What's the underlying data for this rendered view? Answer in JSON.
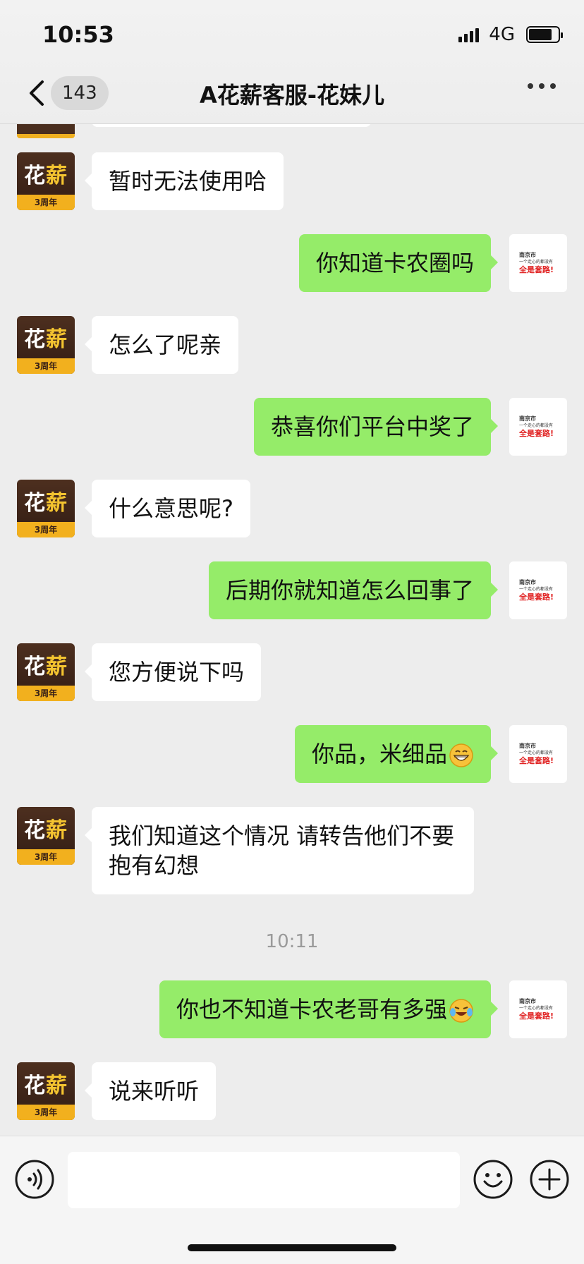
{
  "status_bar": {
    "time": "10:53",
    "network": "4G"
  },
  "header": {
    "back_icon": "chevron-left-icon",
    "unread_count": "143",
    "title": "A花薪客服-花妹儿",
    "more_icon": "more-dots-icon"
  },
  "avatars": {
    "agent": {
      "logo_main": "花",
      "logo_accent": "薪",
      "band": "3周年"
    },
    "user": {
      "line1": "南京市",
      "line2": "一个走心的都没有",
      "line3": "全是套路!"
    }
  },
  "messages": [
    {
      "side": "left",
      "text": "暂时无法使用哈"
    },
    {
      "side": "right",
      "text": "你知道卡农圈吗"
    },
    {
      "side": "left",
      "text": "怎么了呢亲"
    },
    {
      "side": "right",
      "text": "恭喜你们平台中奖了"
    },
    {
      "side": "left",
      "text": "什么意思呢?"
    },
    {
      "side": "right",
      "text": "后期你就知道怎么回事了"
    },
    {
      "side": "left",
      "text": "您方便说下吗"
    },
    {
      "side": "right",
      "text": "你品，米细品",
      "emoji": "grin-emoji-icon"
    },
    {
      "side": "left",
      "text": "我们知道这个情况 请转告他们不要抱有幻想"
    },
    {
      "side": "right",
      "text": "你也不知道卡农老哥有多强",
      "emoji": "laugh-cry-emoji-icon"
    },
    {
      "side": "left",
      "text": "说来听听"
    }
  ],
  "timestamp": "10:11",
  "composer": {
    "voice_icon": "voice-icon",
    "emoji_icon": "emoji-icon",
    "plus_icon": "plus-icon"
  }
}
